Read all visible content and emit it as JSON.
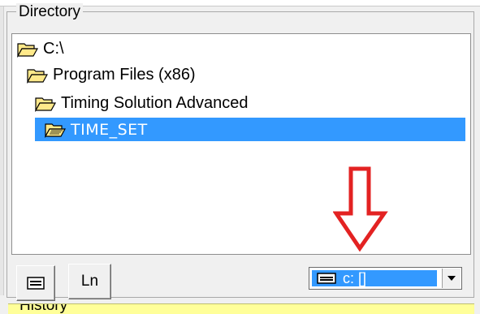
{
  "directory_group": {
    "legend": "Directory"
  },
  "folders": [
    {
      "label": "C:\\",
      "selected": false
    },
    {
      "label": "Program Files (x86)",
      "selected": false
    },
    {
      "label": "Timing Solution Advanced",
      "selected": false
    },
    {
      "label": "TIME_SET",
      "selected": true
    }
  ],
  "buttons": {
    "ln_label": "Ln"
  },
  "drive_select": {
    "value": "c: []"
  },
  "history": {
    "label": "History"
  },
  "colors": {
    "selection": "#3399ff",
    "folder": "#ffe98a",
    "arrow": "#e32222",
    "history_bg": "#ffff99"
  }
}
